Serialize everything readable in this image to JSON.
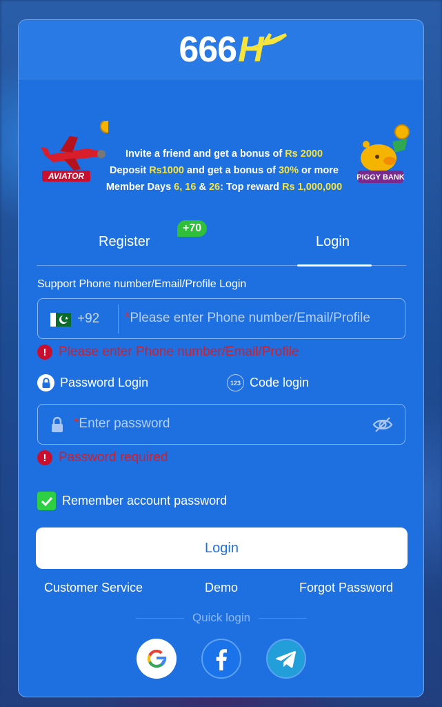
{
  "brand": {
    "logo_text": "666",
    "logo_letter": "H"
  },
  "promo": {
    "line1_pre": "Invite a friend and get a bonus of ",
    "line1_hl": "Rs 2000",
    "line2_a": "Deposit ",
    "line2_hl1": "Rs1000",
    "line2_b": " and get a bonus of ",
    "line2_hl2": "30%",
    "line2_c": " or more",
    "line3_a": "Member Days ",
    "line3_hl1": "6, 16",
    "line3_b": " & ",
    "line3_hl2": "26",
    "line3_c": ": Top reward ",
    "line3_hl3": "Rs 1,000,000",
    "aviator_label": "AVIATOR",
    "piggy_label": "PIGGY BANK"
  },
  "tabs": {
    "register": "Register",
    "register_badge": "+70",
    "login": "Login",
    "active": "login"
  },
  "form": {
    "support_label": "Support Phone number/Email/Profile Login",
    "country_code": "+92",
    "required_mark": "*",
    "phone_placeholder": "Please enter Phone number/Email/Profile",
    "phone_error": "Please enter Phone number/Email/Profile",
    "mode_password": "Password Login",
    "mode_code": "Code login",
    "mode_code_icon_text": "123",
    "password_placeholder": "Enter password",
    "password_error": "Password required",
    "error_icon": "!",
    "remember_label": "Remember account password",
    "remember_checked": true,
    "login_button": "Login"
  },
  "links": {
    "customer_service": "Customer Service",
    "demo": "Demo",
    "forgot_password": "Forgot Password"
  },
  "quick_login": {
    "label": "Quick login",
    "providers": [
      "google-icon",
      "facebook-icon",
      "telegram-icon"
    ]
  },
  "colors": {
    "card_bg": "#1e6fe0",
    "accent_yellow": "#f5e43c",
    "error_red": "#d21e2a",
    "check_green": "#2fcf45"
  }
}
